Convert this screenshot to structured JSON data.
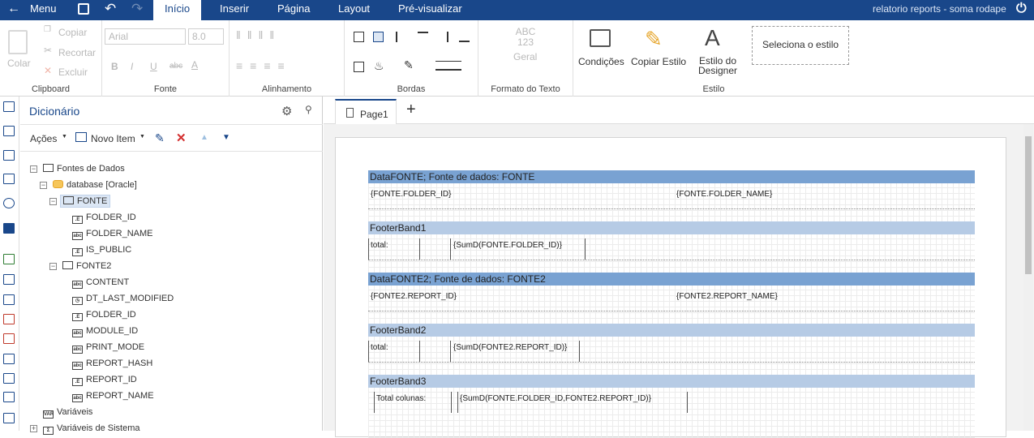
{
  "topbar": {
    "menu_label": "Menu",
    "tabs": [
      "Início",
      "Inserir",
      "Página",
      "Layout",
      "Pré-visualizar"
    ],
    "report_title": "relatorio reports - soma rodape"
  },
  "ribbon": {
    "clipboard": {
      "label": "Clipboard",
      "paste": "Colar",
      "copy": "Copiar",
      "cut": "Recortar",
      "delete": "Excluir"
    },
    "fonte": {
      "label": "Fonte",
      "font_name": "Arial",
      "font_size": "8.0"
    },
    "alinhamento": {
      "label": "Alinhamento"
    },
    "bordas": {
      "label": "Bordas"
    },
    "formato": {
      "label": "Formato do Texto",
      "icon_text": "ABC 123",
      "general": "Geral"
    },
    "estilo": {
      "label": "Estilo",
      "conditions": "Condições",
      "copy_style": "Copiar Estilo",
      "designer_style": "Estilo do Designer",
      "select_style": "Seleciona o estilo"
    }
  },
  "dictionary": {
    "title": "Dicionário",
    "actions": "Ações",
    "new_item": "Novo Item",
    "tree": {
      "datasources": "Fontes de Dados",
      "database": "database [Oracle]",
      "fonte": "FONTE",
      "fonte_fields": [
        "FOLDER_ID",
        "FOLDER_NAME",
        "IS_PUBLIC"
      ],
      "fonte2": "FONTE2",
      "fonte2_fields": [
        "CONTENT",
        "DT_LAST_MODIFIED",
        "FOLDER_ID",
        "MODULE_ID",
        "PRINT_MODE",
        "REPORT_HASH",
        "REPORT_ID",
        "REPORT_NAME"
      ],
      "variables": "Variáveis",
      "system_variables": "Variáveis de Sistema"
    }
  },
  "designer": {
    "page_tab": "Page1",
    "bands": {
      "data1": "DataFONTE; Fonte de dados: FONTE",
      "data1_f1": "{FONTE.FOLDER_ID}",
      "data1_f2": "{FONTE.FOLDER_NAME}",
      "footer1": "FooterBand1",
      "footer1_lbl": "total:",
      "footer1_sum": "{SumD(FONTE.FOLDER_ID)}",
      "data2": "DataFONTE2; Fonte de dados: FONTE2",
      "data2_f1": "{FONTE2.REPORT_ID}",
      "data2_f2": "{FONTE2.REPORT_NAME}",
      "footer2": "FooterBand2",
      "footer2_lbl": "total:",
      "footer2_sum": "{SumD(FONTE2.REPORT_ID)}",
      "footer3": "FooterBand3",
      "footer3_lbl": "Total colunas:",
      "footer3_sum": "{SumD(FONTE.FOLDER_ID,FONTE2.REPORT_ID)}"
    }
  }
}
